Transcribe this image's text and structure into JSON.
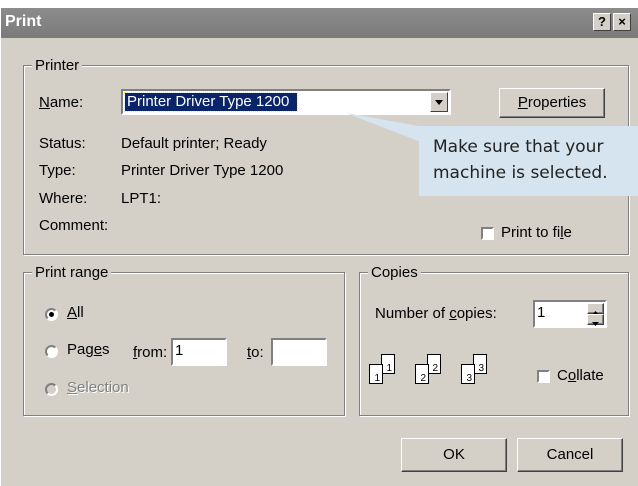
{
  "dialog": {
    "title": "Print"
  },
  "titlebar": {
    "help": "?",
    "close": "×"
  },
  "printer": {
    "legend": "Printer",
    "name_label": "Name:",
    "name_value": "Printer Driver Type 1200",
    "properties_button": "Properties",
    "status_label": "Status:",
    "status_value": "Default printer; Ready",
    "type_label": "Type:",
    "type_value": "Printer Driver Type 1200",
    "where_label": "Where:",
    "where_value": "LPT1:",
    "comment_label": "Comment:",
    "print_to_file": "Print to file",
    "print_to_file_checked": false
  },
  "callout": {
    "line1": "Make sure that your",
    "line2": "machine is selected."
  },
  "print_range": {
    "legend": "Print range",
    "all": "All",
    "pages": "Pages",
    "from_label": "from:",
    "from_value": "1",
    "to_label": "to:",
    "to_value": "",
    "selection": "Selection",
    "selected": "All"
  },
  "copies": {
    "legend": "Copies",
    "number_label": "Number of copies:",
    "number_value": "1",
    "collate": "Collate",
    "collate_checked": false,
    "collate_pages": [
      "1",
      "1",
      "2",
      "2",
      "3",
      "3"
    ]
  },
  "footer": {
    "ok": "OK",
    "cancel": "Cancel"
  }
}
